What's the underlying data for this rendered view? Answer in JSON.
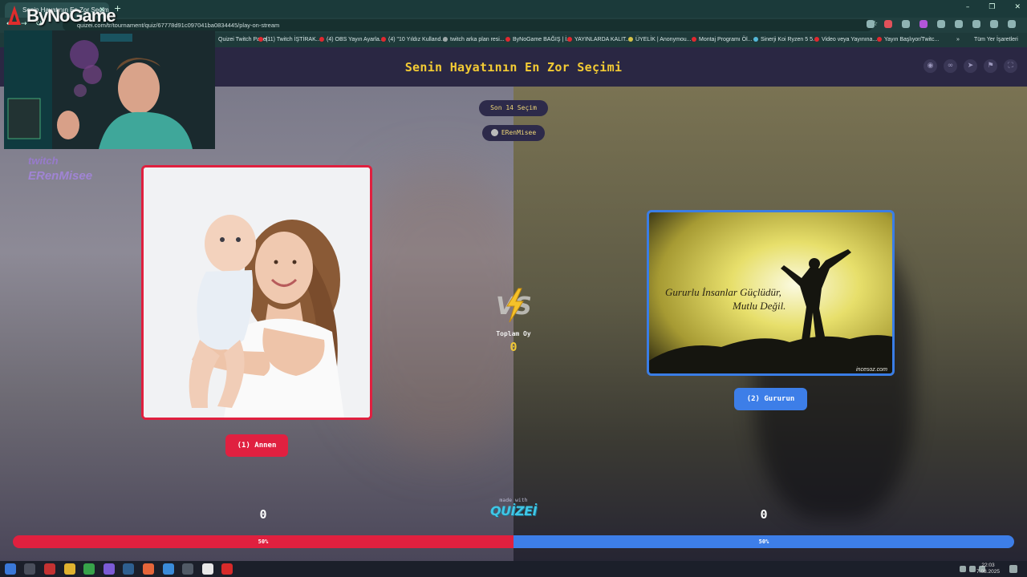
{
  "browser": {
    "tab_title": "Senin Hayatının En Zor Seçimi",
    "url": "quizei.com/tr/tournament/quiz/67778d91c097041ba0834445/play-on-stream",
    "bookmarks": [
      "Quizei Twitch Panel",
      "(11) Twitch İŞTİRAK...",
      "(4) OBS Yayın Ayarla...",
      "(4) \"10 Yıldız Kulland...",
      "twitch arka plan resi...",
      "ByNoGame BAĞIŞ | İ...",
      "YAYINLARDA KALIT...",
      "ÜYELİK | Anonymou...",
      "Montaj Programı Öl...",
      "Sinerji Koi Ryzen 5 5...",
      "Video veya Yayınına...",
      "Yayın Başlıyor/Twitc..."
    ],
    "all_bookmarks": "Tüm Yer İşaretleri"
  },
  "quiz": {
    "title": "Senin Hayatının En Zor Seçimi",
    "round": "Son 14 Seçim",
    "streamer": "ERenMisee",
    "left": {
      "label": "(1) Annen",
      "votes": "0",
      "percent_label": "50%",
      "percent": 50
    },
    "right": {
      "label": "(2) Gururun",
      "votes": "0",
      "percent_label": "50%",
      "percent": 50,
      "image_caption": "Gururlu İnsanlar Güçlüdür,\nMutlu Değil.",
      "watermark": "incesoz.com"
    },
    "total_label": "Toplam Oy",
    "total_votes": "0",
    "made_with": "made with",
    "brand": "QUİZEİ"
  },
  "overlay": {
    "sponsor": "ByNoGame",
    "twitch": "twitch",
    "twitch_user": "ERenMisee"
  },
  "taskbar": {
    "time": "22:03",
    "date": "7.08.2025"
  },
  "colors": {
    "accent_yellow": "#f3cb34",
    "left_red": "#e0203f",
    "right_blue": "#3d7ee8"
  }
}
